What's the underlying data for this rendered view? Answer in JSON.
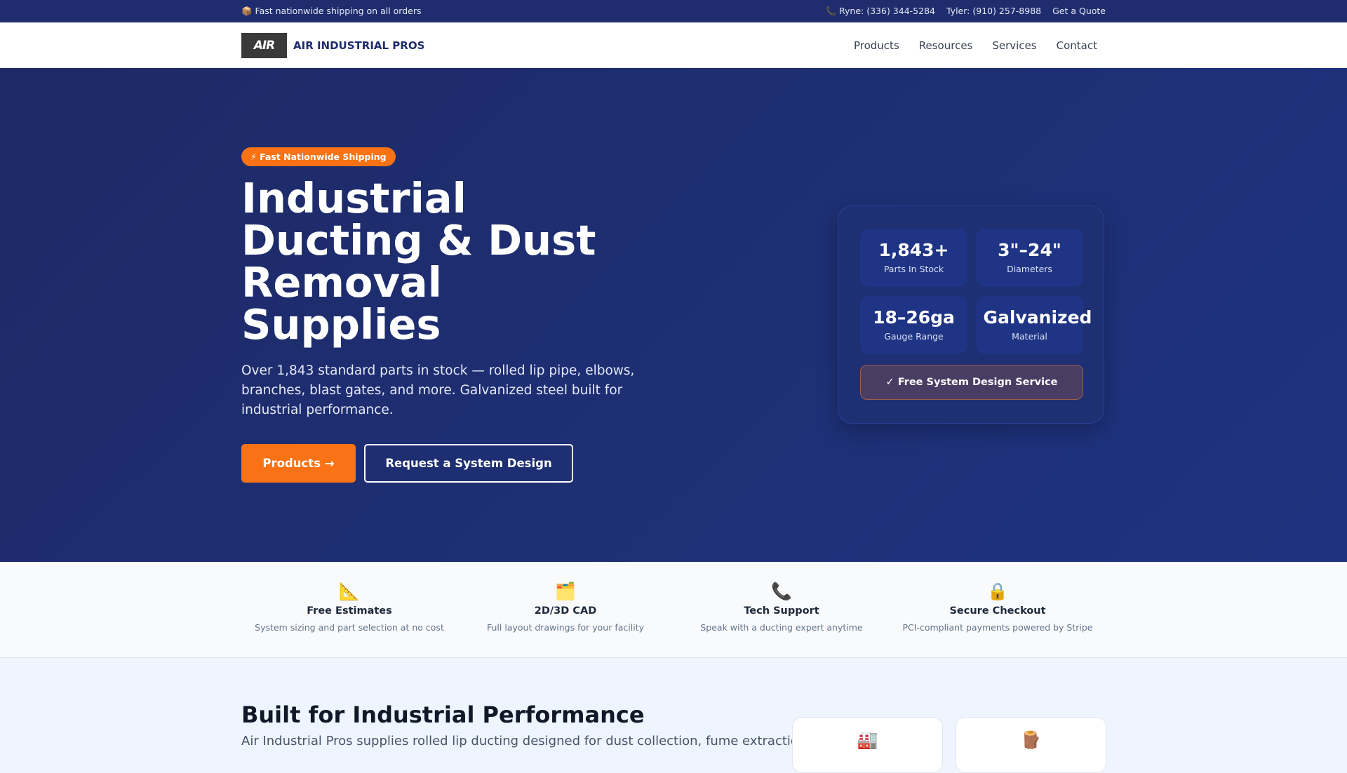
{
  "topbar": {
    "shipping": "📦 Fast nationwide shipping on all orders",
    "ryne": "📞 Ryne: (336) 344-5284",
    "tyler": "Tyler: (910) 257-8988",
    "quote": "Get a Quote"
  },
  "nav": {
    "logo_text": "AIR",
    "brand": "AIR INDUSTRIAL PROS",
    "links": [
      "Products",
      "Resources",
      "Services",
      "Contact"
    ]
  },
  "hero": {
    "badge": "⚡ Fast Nationwide Shipping",
    "title": "Industrial Ducting & Dust Removal Supplies",
    "lead": "Over 1,843 standard parts in stock — rolled lip pipe, elbows, branches, blast gates, and more. Galvanized steel built for industrial performance.",
    "primary_button": "Products →",
    "secondary_button": "Request a System Design",
    "stats": [
      {
        "value": "1,843+",
        "label": "Parts In Stock"
      },
      {
        "value": "3\"–24\"",
        "label": "Diameters"
      },
      {
        "value": "18–26ga",
        "label": "Gauge Range"
      },
      {
        "value": "Galvanized",
        "label": "Material"
      }
    ],
    "design_button": "✓ Free System Design Service"
  },
  "features": [
    {
      "icon": "📐",
      "title": "Free Estimates",
      "desc": "System sizing and part selection at no cost"
    },
    {
      "icon": "🗂️",
      "title": "2D/3D CAD",
      "desc": "Full layout drawings for your facility"
    },
    {
      "icon": "📞",
      "title": "Tech Support",
      "desc": "Speak with a ducting expert anytime"
    },
    {
      "icon": "🔒",
      "title": "Secure Checkout",
      "desc": "PCI-compliant payments powered by Stripe"
    }
  ],
  "section": {
    "title": "Built for Industrial Performance",
    "text": "Air Industrial Pros supplies rolled lip ducting designed for dust collection, fume extraction,",
    "cards": [
      {
        "icon": "🏭"
      },
      {
        "icon": "🪵"
      }
    ]
  }
}
